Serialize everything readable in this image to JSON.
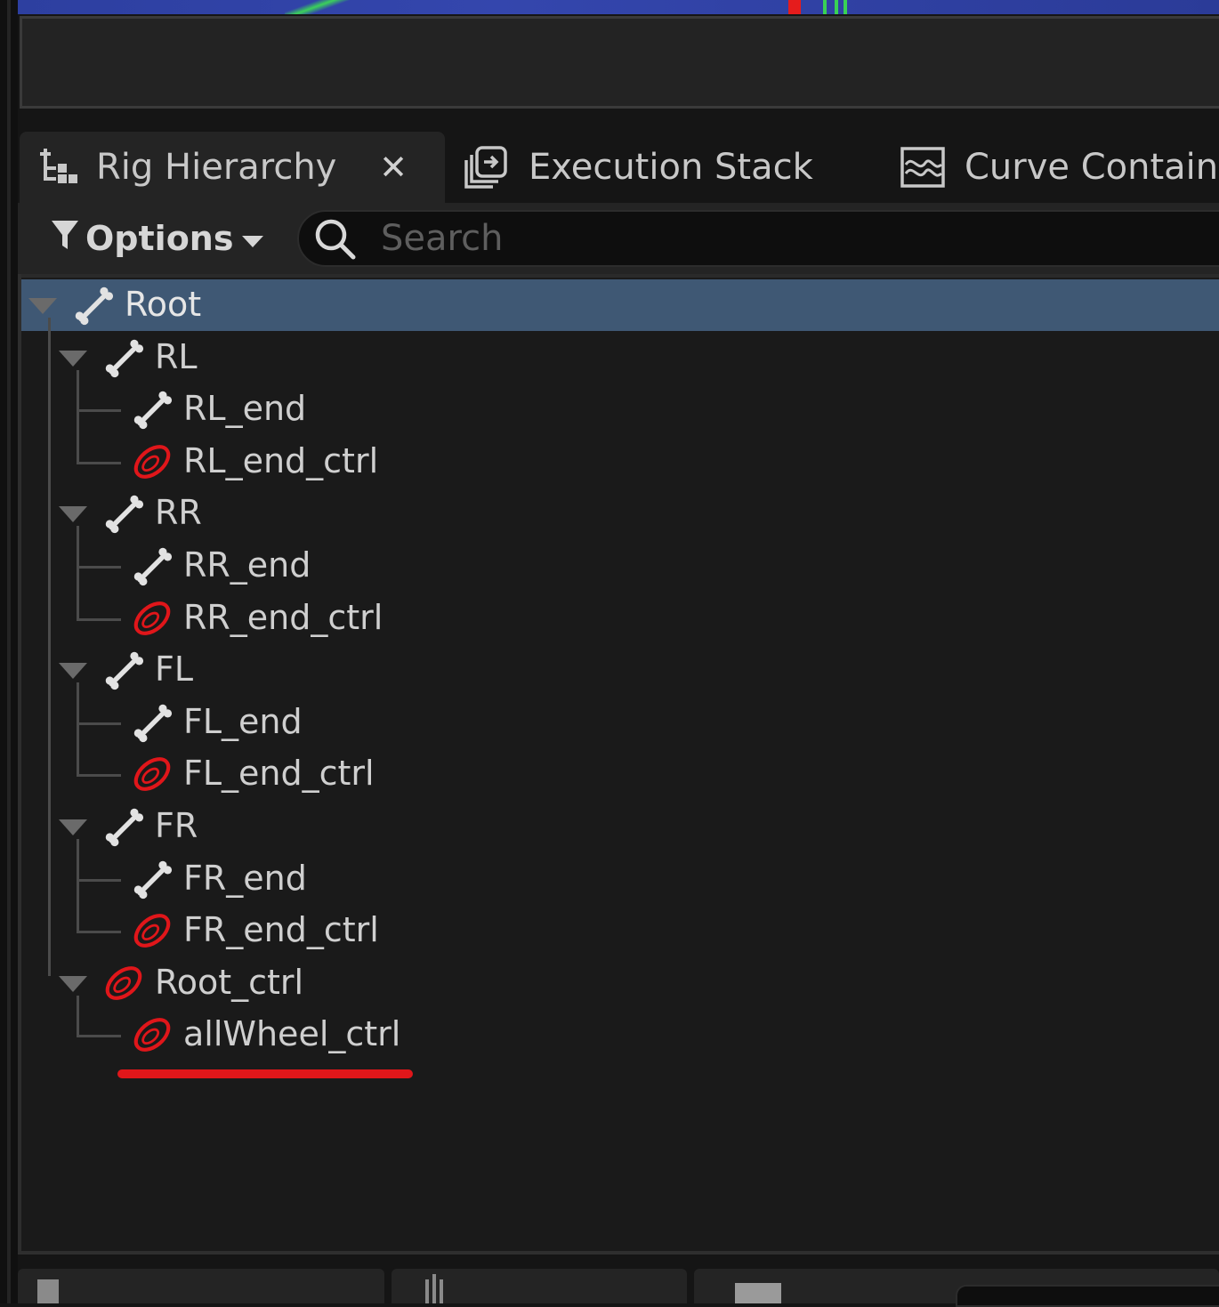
{
  "tabs": [
    {
      "label": "Rig Hierarchy",
      "icon": "rig-hierarchy-icon",
      "active": true,
      "closable": true
    },
    {
      "label": "Execution Stack",
      "icon": "execution-stack-icon",
      "active": false
    },
    {
      "label": "Curve Containe",
      "icon": "curve-container-icon",
      "active": false
    }
  ],
  "toolbar": {
    "options_label": "Options",
    "search_placeholder": "Search"
  },
  "tree": {
    "items": [
      {
        "label": "Root",
        "type": "bone",
        "depth": 0,
        "expanded": true,
        "selected": true
      },
      {
        "label": "RL",
        "type": "bone",
        "depth": 1,
        "expanded": true
      },
      {
        "label": "RL_end",
        "type": "bone",
        "depth": 2
      },
      {
        "label": "RL_end_ctrl",
        "type": "control",
        "depth": 2
      },
      {
        "label": "RR",
        "type": "bone",
        "depth": 1,
        "expanded": true
      },
      {
        "label": "RR_end",
        "type": "bone",
        "depth": 2
      },
      {
        "label": "RR_end_ctrl",
        "type": "control",
        "depth": 2
      },
      {
        "label": "FL",
        "type": "bone",
        "depth": 1,
        "expanded": true
      },
      {
        "label": "FL_end",
        "type": "bone",
        "depth": 2
      },
      {
        "label": "FL_end_ctrl",
        "type": "control",
        "depth": 2
      },
      {
        "label": "FR",
        "type": "bone",
        "depth": 1,
        "expanded": true
      },
      {
        "label": "FR_end",
        "type": "bone",
        "depth": 2
      },
      {
        "label": "FR_end_ctrl",
        "type": "control",
        "depth": 2
      },
      {
        "label": "Root_ctrl",
        "type": "control",
        "depth": 1,
        "expanded": true
      },
      {
        "label": "allWheel_ctrl",
        "type": "control",
        "depth": 2,
        "annotated": true
      }
    ]
  },
  "colors": {
    "selection": "#3f5874",
    "control_icon": "#e0161a",
    "annotation": "#e0161a"
  }
}
